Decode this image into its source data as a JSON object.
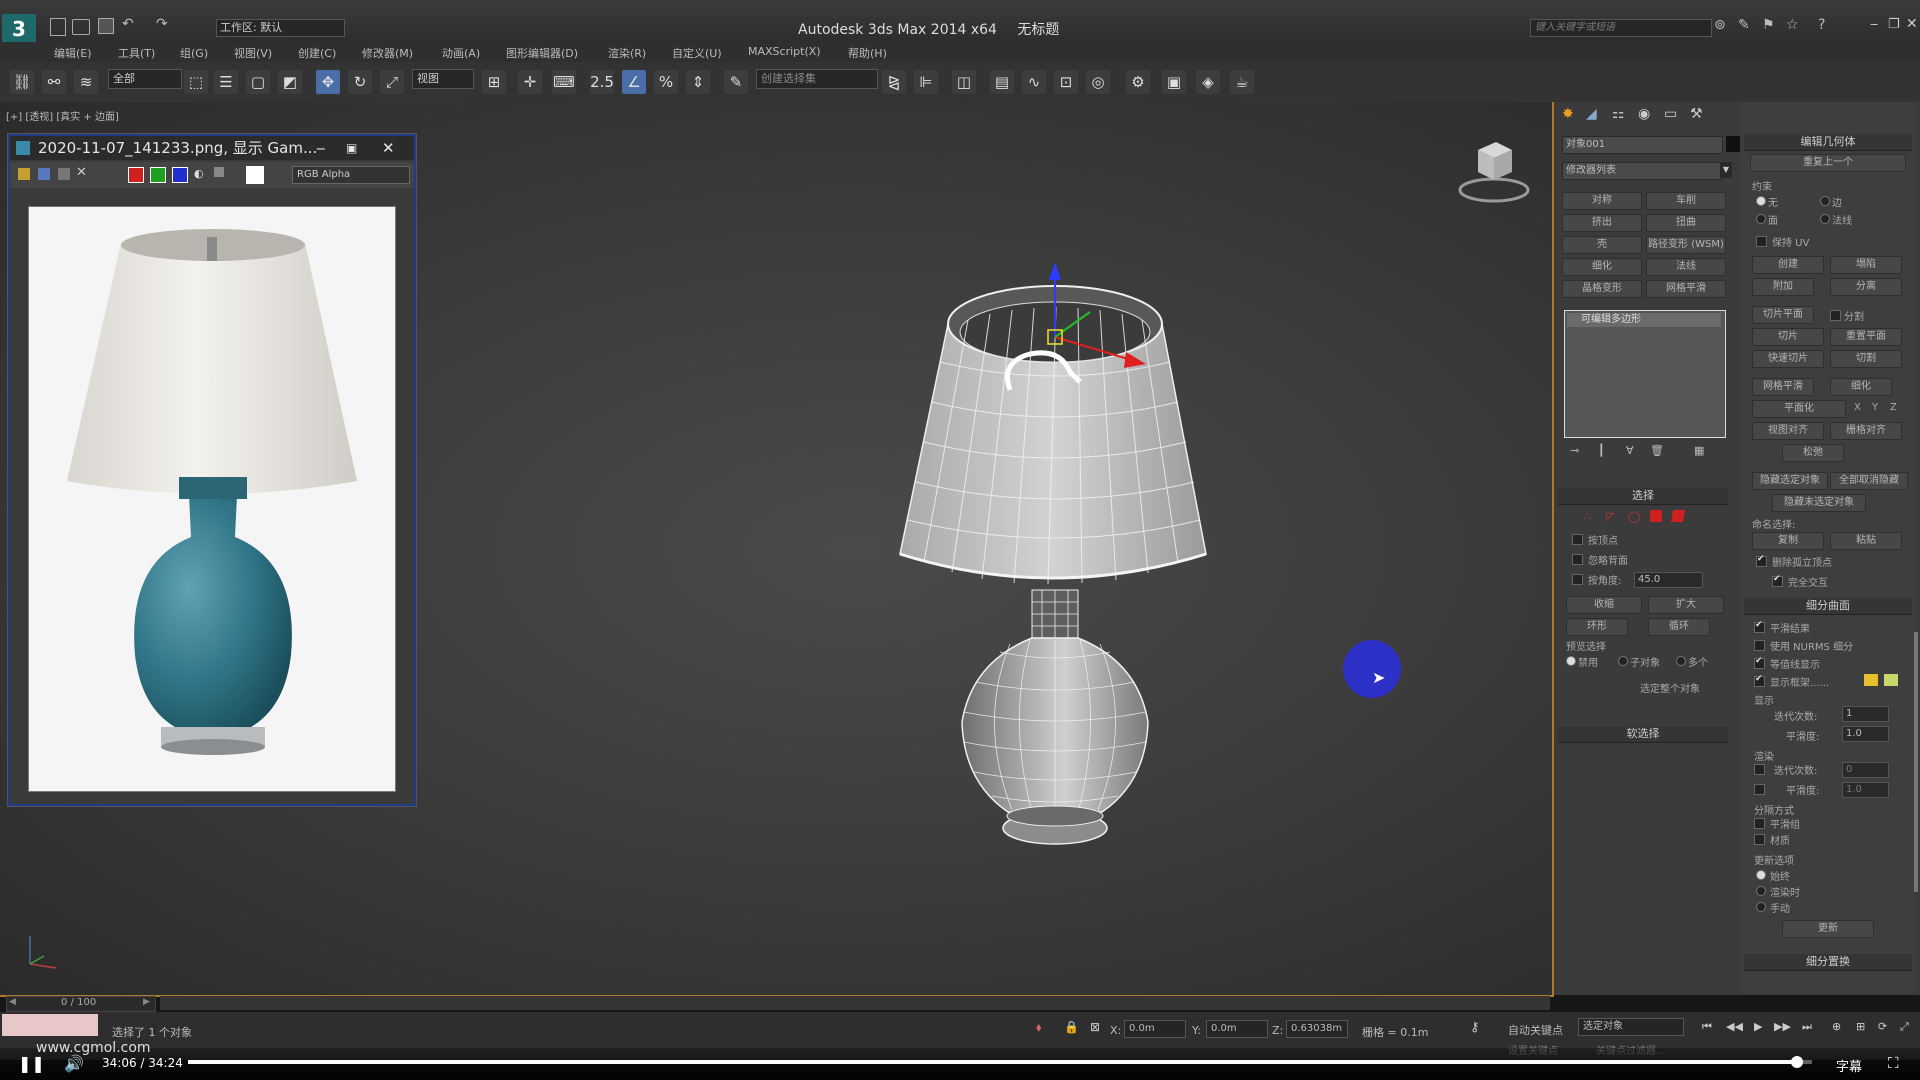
{
  "app": {
    "title": "Autodesk 3ds Max  2014 x64",
    "file_name": "无标题",
    "workspace": "工作区: 默认",
    "search_placeholder": "键入关键字或短语"
  },
  "menu": [
    "编辑(E)",
    "工具(T)",
    "组(G)",
    "视图(V)",
    "创建(C)",
    "修改器(M)",
    "动画(A)",
    "图形编辑器(D)",
    "渲染(R)",
    "自定义(U)",
    "MAXScript(X)",
    "帮助(H)"
  ],
  "toolbar": {
    "selection_filter": "全部",
    "named_selection": "创建选择集",
    "view_label": "视图"
  },
  "viewport": {
    "label": "[+] [透视] [真实 + 边面]",
    "axis_z": "z"
  },
  "image_window": {
    "title": "2020-11-07_141233.png, 显示 Gam...",
    "channel": "RGB Alpha"
  },
  "command_panel": {
    "object_name": "对象001",
    "modifier_list": "修改器列表",
    "modifier_buttons": [
      "对称",
      "车削",
      "挤出",
      "扭曲",
      "壳",
      "路径变形 (WSM)",
      "细化",
      "法线",
      "晶格变形",
      "网格平滑"
    ],
    "stack_item": "可编辑多边形",
    "selection": {
      "title": "选择",
      "by_vertex": "按顶点",
      "ignore_backfacing": "忽略背面",
      "by_angle": "按角度:",
      "angle_value": "45.0",
      "shrink": "收缩",
      "grow": "扩大",
      "ring": "环形",
      "loop": "循环",
      "preview_selection": "预览选择",
      "preview_options": [
        "禁用",
        "子对象",
        "多个"
      ],
      "whole_object": "选定整个对象"
    },
    "soft_selection": "软选择",
    "edit_geometry": {
      "title": "编辑几何体",
      "repeat_last": "重复上一个",
      "constraints": "约束",
      "constraint_options": [
        "无",
        "边",
        "面",
        "法线"
      ],
      "preserve_uv": "保持 UV",
      "create": "创建",
      "collapse": "塌陷",
      "attach": "附加",
      "detach": "分离",
      "slice_plane": "切片平面",
      "split": "分割",
      "slice": "切片",
      "reset_plane": "重置平面",
      "quickslice": "快速切片",
      "cut": "切割",
      "meshsmooth": "网格平滑",
      "tessellate": "细化",
      "make_planar": "平面化",
      "xyz": [
        "X",
        "Y",
        "Z"
      ],
      "view_align": "视图对齐",
      "grid_align": "栅格对齐",
      "relax": "松弛",
      "hide_selected": "隐藏选定对象",
      "unhide_all": "全部取消隐藏",
      "hide_unselected": "隐藏未选定对象",
      "named_selections": "命名选择:",
      "copy": "复制",
      "paste": "粘贴",
      "delete_isolated": "删除孤立顶点",
      "full_interactivity": "完全交互"
    },
    "subdivision_surface": {
      "title": "细分曲面",
      "smooth_result": "平滑结果",
      "use_nurms": "使用 NURMS 细分",
      "isoline_display": "等值线显示",
      "show_cage": "显示框架......",
      "display": "显示",
      "iterations": "迭代次数:",
      "iterations_value": "1",
      "smoothness": "平滑度:",
      "smoothness_value": "1.0",
      "render": "渲染",
      "render_iterations_value": "0",
      "render_smoothness_value": "1.0",
      "separate_by": "分隔方式",
      "smoothing_groups": "平滑组",
      "materials": "材质",
      "update_options": "更新选项",
      "update_modes": [
        "始终",
        "渲染时",
        "手动"
      ],
      "update_button": "更新"
    },
    "subdivision_displacement": "细分置换"
  },
  "timeline": {
    "frame": "0 / 100"
  },
  "status": {
    "selected": "选择了 1 个对象",
    "x": "0.0m",
    "y": "0.0m",
    "z": "0.63038m",
    "grid": "栅格 = 0.1m",
    "auto_key": "自动关键点",
    "key_mode": "选定对象",
    "set_key": "设置关键点",
    "key_filters": "关键点过滤器..."
  },
  "player": {
    "time": "34:06 / 34:24",
    "subtitle": "字幕",
    "watermark": "www.cgmol.com",
    "progress": 0.991
  },
  "colors": {
    "accent": "#4a6ea8",
    "viewport_border": "#b07a2a",
    "image_border": "#223a8a",
    "cursor": "#2b2fd6",
    "swatch_yellow": "#e8c02a",
    "swatch_green": "#c6d86a"
  }
}
